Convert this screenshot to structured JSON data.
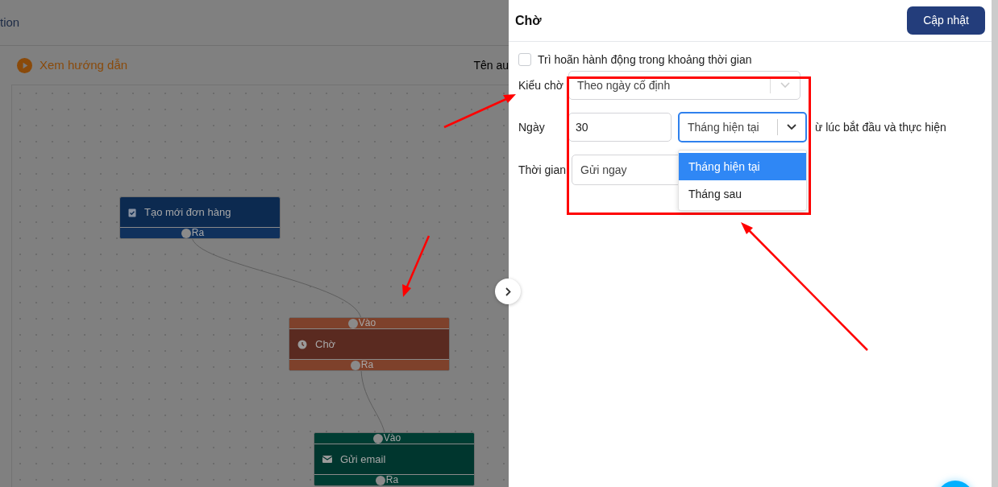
{
  "background": {
    "header_text": "tion",
    "guide_link": "Xem hướng dẫn",
    "name_label": "Tên au"
  },
  "flow_nodes": [
    {
      "kind": "trigger",
      "title": "Tạo mới đơn hàng",
      "color": "#0c2a50",
      "output_port": "Ra"
    },
    {
      "kind": "wait",
      "title": "Chờ",
      "color": "#5a2a20",
      "input_port": "Vào",
      "output_port": "Ra"
    },
    {
      "kind": "email",
      "title": "Gửi email",
      "color": "#00362e",
      "input_port": "Vào",
      "output_port": "Ra"
    }
  ],
  "panel": {
    "title": "Chờ",
    "save_button": "Cập nhật",
    "delay_checkbox": {
      "label": "Trì hoãn hành động trong khoảng thời gian",
      "checked": false
    },
    "wait_type": {
      "label": "Kiểu chờ",
      "value": "Theo ngày cố định"
    },
    "day": {
      "label": "Ngày",
      "value": "30",
      "month_select": {
        "value": "Tháng hiện tại",
        "expanded": true,
        "options": [
          {
            "label": "Tháng hiện tại",
            "selected": true
          },
          {
            "label": "Tháng sau",
            "selected": false
          }
        ]
      },
      "suffix": "ừ lúc bắt đầu và thực hiện"
    },
    "time": {
      "label": "Thời gian",
      "value": "Gửi ngay"
    }
  }
}
